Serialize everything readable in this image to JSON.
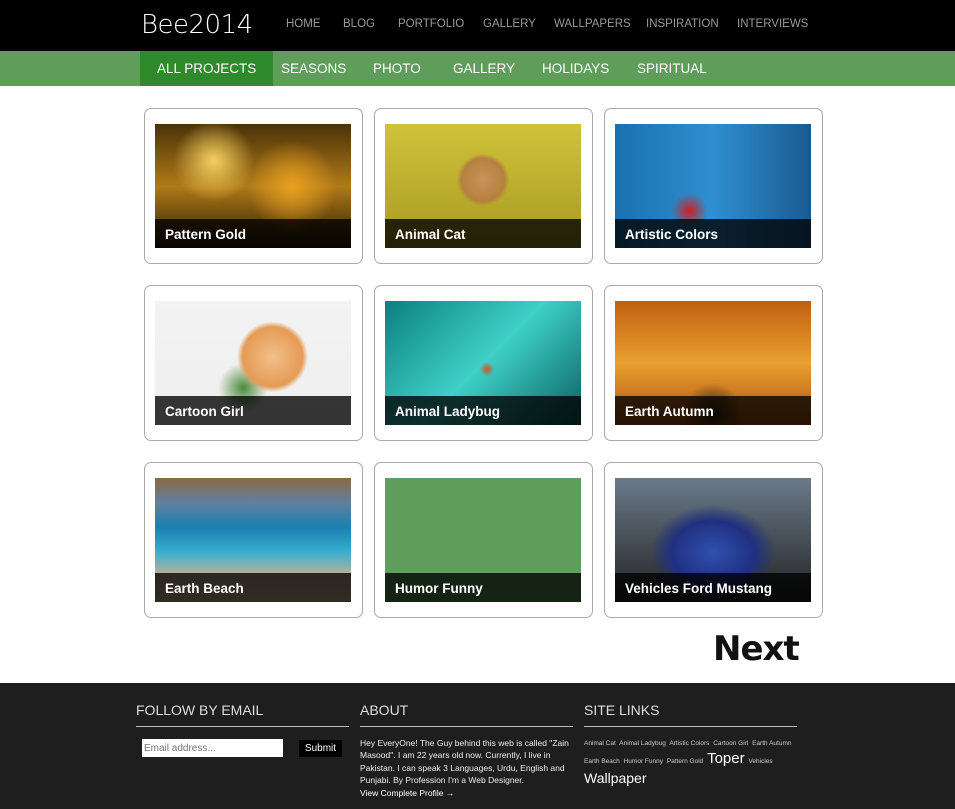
{
  "header": {
    "logo": "Bee2014",
    "nav": [
      "HOME",
      "BLOG",
      "PORTFOLIO",
      "GALLERY",
      "WALLPAPERS",
      "INSPIRATION",
      "INTERVIEWS"
    ]
  },
  "subnav": {
    "items": [
      "ALL PROJECTS",
      "SEASONS",
      "PHOTO",
      "GALLERY",
      "HOLIDAYS",
      "SPIRITUAL"
    ],
    "active": "ALL PROJECTS"
  },
  "projects": [
    {
      "title": "Pattern Gold"
    },
    {
      "title": "Animal Cat"
    },
    {
      "title": "Artistic Colors"
    },
    {
      "title": "Cartoon Girl"
    },
    {
      "title": "Animal Ladybug"
    },
    {
      "title": "Earth Autumn"
    },
    {
      "title": "Earth Beach"
    },
    {
      "title": "Humor Funny"
    },
    {
      "title": "Vehicles Ford Mustang"
    }
  ],
  "pagination": {
    "next": "Next"
  },
  "footer": {
    "follow": {
      "title": "FOLLOW BY EMAIL",
      "placeholder": "Email address...",
      "submit": "Submit"
    },
    "about": {
      "title": "ABOUT",
      "text": "Hey EveryOne! The Guy behind this web is called \"Zain Masood\". I am 22 years old now. Currently, I live in Pakistan. I can speak 3 Languages, Urdu, English and Punjabi. By Profession I'm a Web Designer.",
      "link": "View Complete Profile →"
    },
    "links": {
      "title": "SITE LINKS",
      "tags": [
        "Animal Cat",
        "Animal Ladybug",
        "Artistic Colors",
        "Cartoon Girl",
        "Earth Autumn",
        "Earth Beach",
        "Humor Funny",
        "Pattern Gold",
        "Toper",
        "Vehicles",
        "Wallpaper"
      ]
    }
  },
  "colors": {
    "accent": "#5e9e5a",
    "active": "#2e8a2a",
    "footer": "#1e1e1e"
  }
}
